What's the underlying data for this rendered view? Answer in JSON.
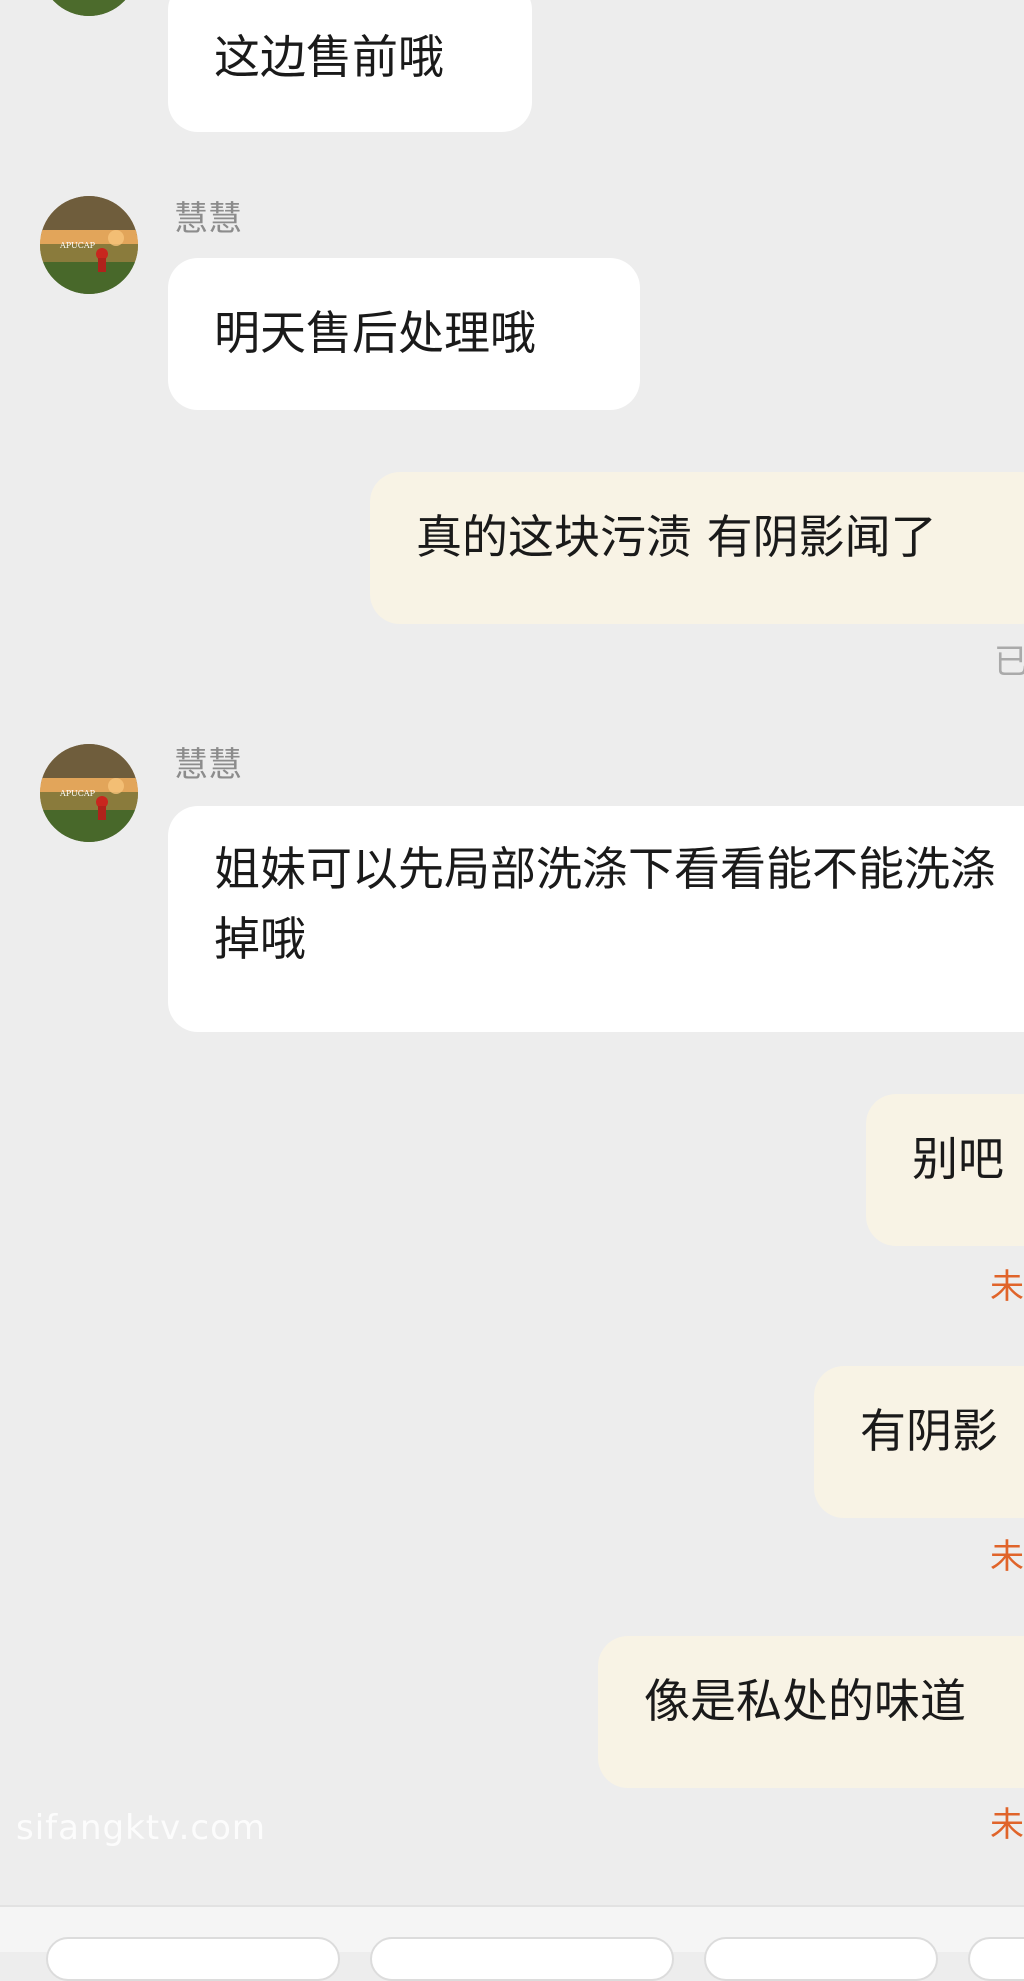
{
  "messages": [
    {
      "direction": "incoming",
      "text": "这边售前哦"
    },
    {
      "direction": "incoming",
      "sender": "慧慧",
      "text": "明天售后处理哦"
    },
    {
      "direction": "outgoing",
      "text": "真的这块污渍 有阴影闻了",
      "status": "已"
    },
    {
      "direction": "incoming",
      "sender": "慧慧",
      "text": "姐妹可以先局部洗涤下看看能不能洗涤掉哦"
    },
    {
      "direction": "outgoing",
      "text": "别吧",
      "status": "未"
    },
    {
      "direction": "outgoing",
      "text": "有阴影",
      "status": "未"
    },
    {
      "direction": "outgoing",
      "text": "像是私处的味道",
      "status": "未"
    }
  ],
  "avatar": {
    "icon": "landscape-avatar-icon",
    "overlay_text": "APUCAP"
  },
  "watermark": "sifangktv.com",
  "colors": {
    "background": "#ededed",
    "incoming_bubble": "#ffffff",
    "outgoing_bubble": "#f8f3e5",
    "unread_status": "#e0642a",
    "read_status": "#aaaaaa"
  }
}
